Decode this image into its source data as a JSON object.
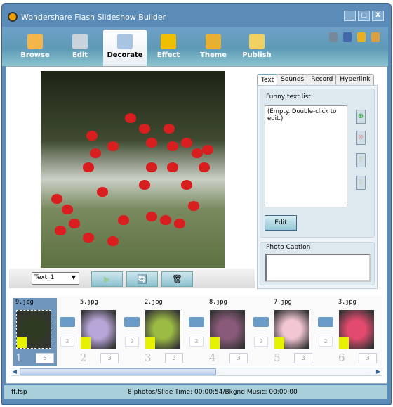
{
  "window": {
    "title": "Wondershare Flash Slideshow Builder",
    "controls": [
      "_",
      "□",
      "X"
    ]
  },
  "toolbar": {
    "tabs": [
      {
        "label": "Browse",
        "icon": "folder-icon",
        "color": "#f3b64a"
      },
      {
        "label": "Edit",
        "icon": "tools-icon",
        "color": "#c9d3dc"
      },
      {
        "label": "Decorate",
        "icon": "decorate-icon",
        "color": "#a9c4e0",
        "active": true
      },
      {
        "label": "Effect",
        "icon": "film-icon",
        "color": "#f0c000"
      },
      {
        "label": "Theme",
        "icon": "theme-icon",
        "color": "#e8b030"
      },
      {
        "label": "Publish",
        "icon": "publish-icon",
        "color": "#f0d060"
      }
    ],
    "right_icons": [
      "recycle-icon",
      "save-icon",
      "key-icon",
      "user-icon"
    ]
  },
  "preview": {
    "text_select": "Text_1",
    "buttons": [
      "play-icon",
      "add-effect-icon",
      "trash-icon"
    ]
  },
  "side_panel": {
    "tabs": [
      "Text",
      "Sounds",
      "Record",
      "Hyperlink"
    ],
    "active_tab": "Text",
    "list_label": "Funny text list:",
    "list_placeholder": "(Empty. Double-click to edit.)",
    "edit_label": "Edit",
    "caption_label": "Photo Caption",
    "caption_value": ""
  },
  "filmstrip": {
    "slides": [
      {
        "name": "9.jpg",
        "index": "1",
        "duration": "5",
        "selected": true,
        "color": "#2f3a22"
      },
      {
        "name": "5.jpg",
        "index": "2",
        "duration": "3",
        "color": "#b9a6d9"
      },
      {
        "name": "2.jpg",
        "index": "3",
        "duration": "3",
        "color": "#9cbb44"
      },
      {
        "name": "8.jpg",
        "index": "4",
        "duration": "3",
        "color": "#8a5a7a"
      },
      {
        "name": "7.jpg",
        "index": "5",
        "duration": "3",
        "color": "#f2c6d2"
      },
      {
        "name": "3.jpg",
        "index": "6",
        "duration": "3",
        "color": "#e24a6e"
      }
    ],
    "transition_durations": [
      "2",
      "2",
      "2",
      "2",
      "2"
    ]
  },
  "status": {
    "file": "ff.fsp",
    "info": "8 photos/Slide Time: 00:00:54/Bkgnd Music: 00:00:00"
  }
}
